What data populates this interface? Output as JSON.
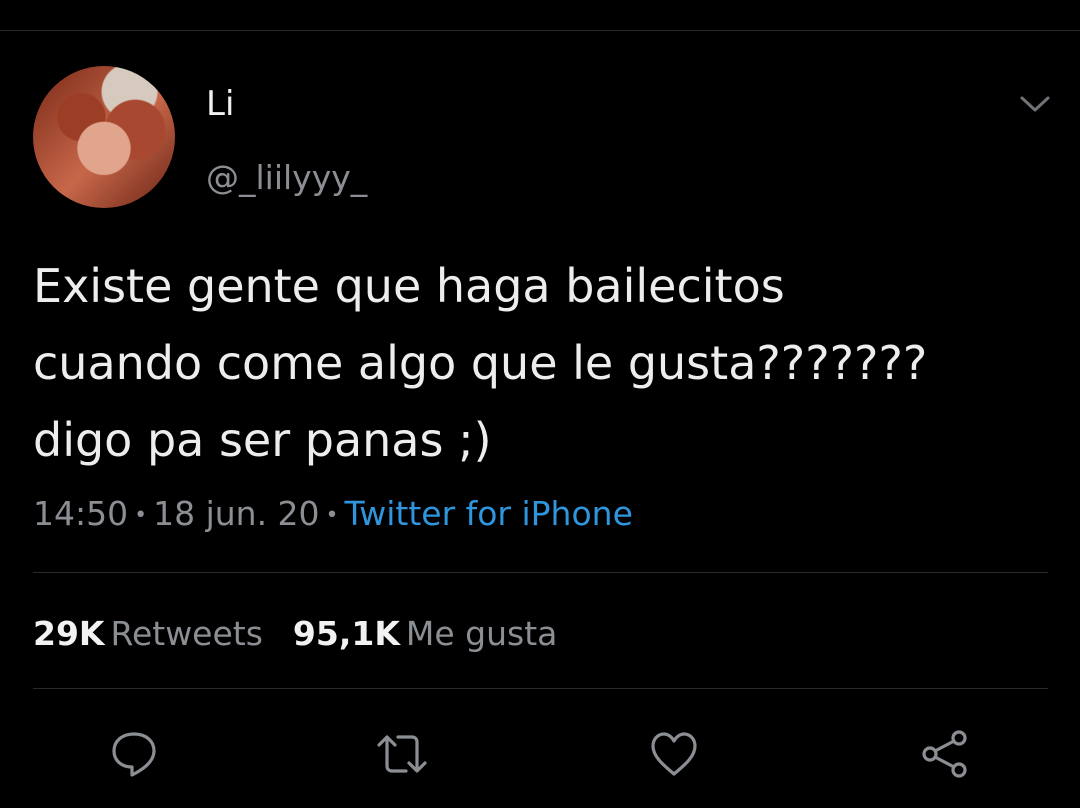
{
  "user": {
    "display_name": "Li",
    "handle": "@_liilyyy_"
  },
  "tweet": {
    "lines": [
      "Existe gente que haga bailecitos",
      "cuando come algo que le gusta???????",
      "digo pa ser panas ;)"
    ],
    "time": "14:50",
    "date": "18 jun. 20",
    "source": "Twitter for iPhone"
  },
  "stats": {
    "retweets_count": "29K",
    "retweets_label": "Retweets",
    "likes_count": "95,1K",
    "likes_label": "Me gusta"
  },
  "icons": {
    "menu": "chevron-down-icon",
    "reply": "reply-icon",
    "retweet": "retweet-icon",
    "like": "heart-icon",
    "share": "share-icon"
  },
  "colors": {
    "background": "#000000",
    "text": "#ededed",
    "muted": "#8b8f94",
    "link": "#2f95dc",
    "divider": "#2a2a2a"
  }
}
